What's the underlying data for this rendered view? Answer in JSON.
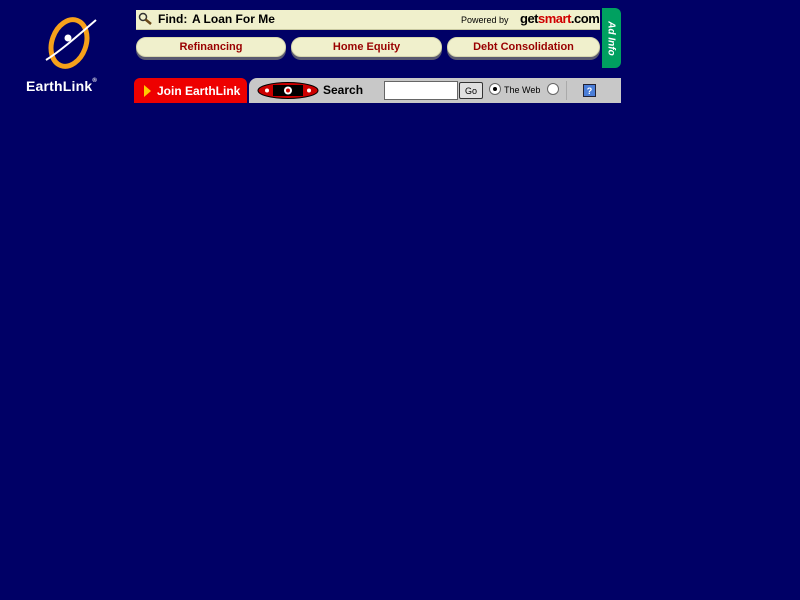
{
  "logo": {
    "text": "EarthLink",
    "trademark": "®"
  },
  "ad": {
    "find_label": "Find:",
    "find_value": "A Loan For Me",
    "powered_by": "Powered by",
    "brand_a": "get",
    "brand_b": "smart",
    "brand_c": ".com",
    "buttons": [
      "Refinancing",
      "Home Equity",
      "Debt Consolidation"
    ],
    "ad_info": "Ad Info"
  },
  "nav": {
    "join_label": "Join EarthLink",
    "search_label": "Search",
    "search_value": "",
    "go_label": "Go",
    "radio_web_label": "The Web",
    "help_label": "?"
  },
  "colors": {
    "background": "#000066",
    "accent_red": "#ee0000",
    "ad_green": "#00a060",
    "button_text": "#990000"
  }
}
